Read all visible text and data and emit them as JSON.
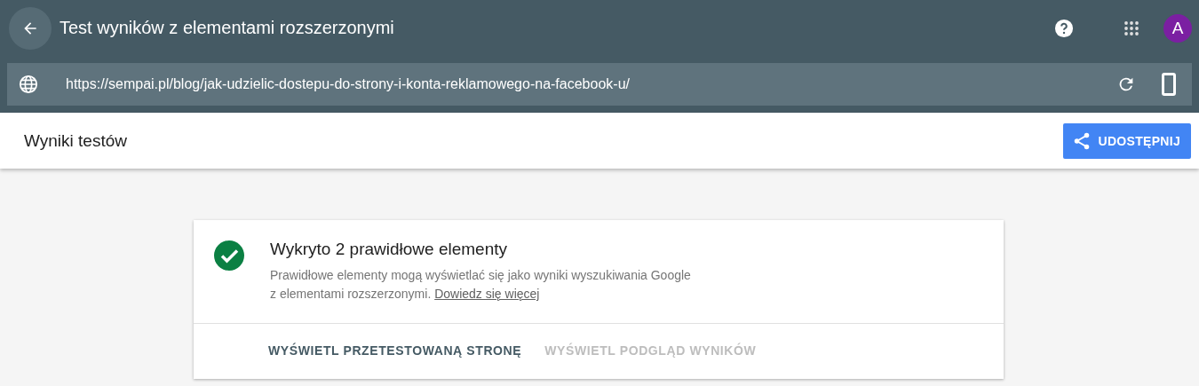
{
  "header": {
    "title": "Test wyników z elementami rozszerzonymi",
    "avatar": "A",
    "url": "https://sempai.pl/blog/jak-udzielic-dostepu-do-strony-i-konta-reklamowego-na-facebook-u/"
  },
  "toolbar": {
    "title": "Wyniki testów",
    "share_button": "UDOSTĘPNIJ"
  },
  "result": {
    "title": "Wykryto 2 prawidłowe elementy",
    "description_line_1": "Prawidłowe elementy mogą wyświetlać się jako wyniki wyszukiwania Google",
    "description_line_2": "z elementami rozszerzonymi.",
    "link": "Dowiedz się więcej",
    "actions": [
      {
        "label": "WYŚWIETL PRZETESTOWANĄ STRONĘ",
        "disabled": false
      },
      {
        "label": "WYŚWIETL PODGLĄD WYNIKÓW",
        "disabled": true
      }
    ]
  }
}
